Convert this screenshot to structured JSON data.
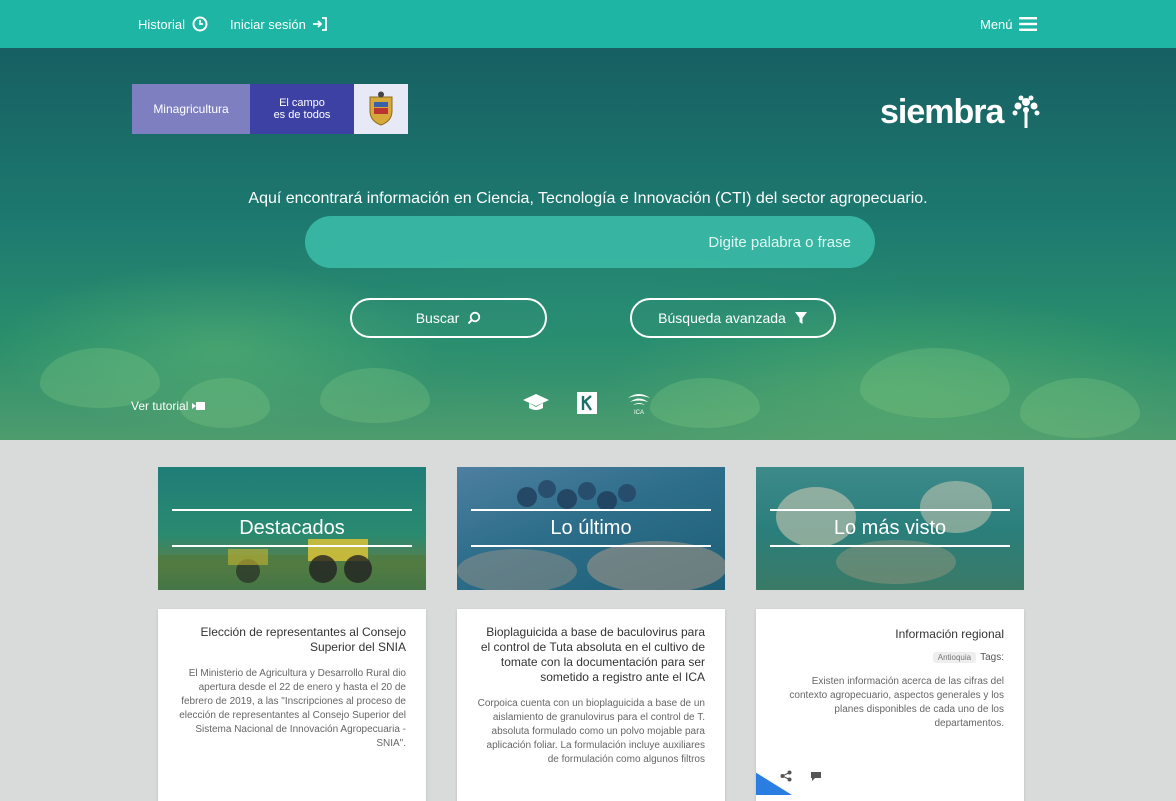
{
  "topbar": {
    "menu_label": "Menú",
    "login_label": "Iniciar sesión",
    "history_label": "Historial"
  },
  "hero": {
    "gov_banner": {
      "left_label": "Minagricultura",
      "middle_line1": "El campo",
      "middle_line2": "es de todos"
    },
    "brand": "siembra",
    "tagline": "Aquí encontrará información en Ciencia, Tecnología e Innovación (CTI) del sector agropecuario.",
    "search_placeholder": "Digite palabra o frase",
    "advanced_search_label": "Búsqueda avanzada",
    "search_button_label": "Buscar",
    "tutorial_label": "Ver tutorial",
    "ic_label": "ICA"
  },
  "cards": [
    {
      "heading": "Destacados",
      "title": "Elección de representantes al Consejo Superior del SNIA",
      "text": "El Ministerio de Agricultura y Desarrollo Rural dio apertura desde el 22 de enero y hasta el 20 de febrero de 2019, a las \"Inscripciones al proceso de elección de representantes al Consejo Superior del Sistema Nacional de Innovación Agropecuaria - SNIA\"."
    },
    {
      "heading": "Lo último",
      "title": "Bioplaguicida a base de baculovirus para el control de Tuta absoluta en el cultivo de tomate con la documentación para ser sometido a registro ante el ICA",
      "text": "Corpoica cuenta con un bioplaguicida a base de un aislamiento de granulovirus para el control de T. absoluta formulado como un polvo mojable para aplicación foliar. La formulación incluye auxiliares de formulación como algunos filtros"
    },
    {
      "heading": "Lo más visto",
      "title": "Información regional",
      "tags_label": "Tags:",
      "tag": "Antioquia",
      "text": "Existen información acerca de las cifras del contexto agropecuario, aspectos generales y los planes disponibles de cada uno de los departamentos."
    }
  ],
  "colors": {
    "topbar": "#1fb5a4",
    "card_heading_overlay": "#1d7f7a",
    "search_fill": "#3cbeaa"
  }
}
